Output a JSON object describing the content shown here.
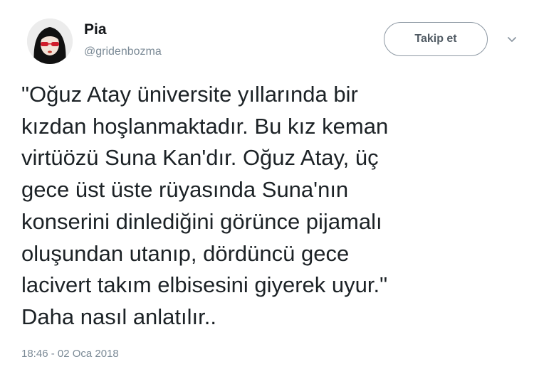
{
  "user": {
    "name": "Pia",
    "handle": "@gridenbozma",
    "avatar_icon": "avatar-icon"
  },
  "follow_button": {
    "label": "Takip et"
  },
  "more_icon": "chevron-down-icon",
  "tweet": {
    "lines": [
      "\"Oğuz Atay üniversite yıllarında bir",
      "kızdan hoşlanmaktadır. Bu kız keman",
      "virtüözü Suna Kan'dır. Oğuz Atay, üç",
      "gece üst üste rüyasında Suna'nın",
      "konserini dinlediğini görünce pijamalı",
      "oluşundan utanıp, dördüncü gece",
      "lacivert takım elbisesini giyerek uyur.\"",
      "Daha nasıl anlatılır.."
    ],
    "timestamp": "18:46 - 02 Oca 2018"
  },
  "colors": {
    "text": "#1c2226",
    "secondary": "#7b8a96",
    "button_border": "#8d98a3"
  }
}
